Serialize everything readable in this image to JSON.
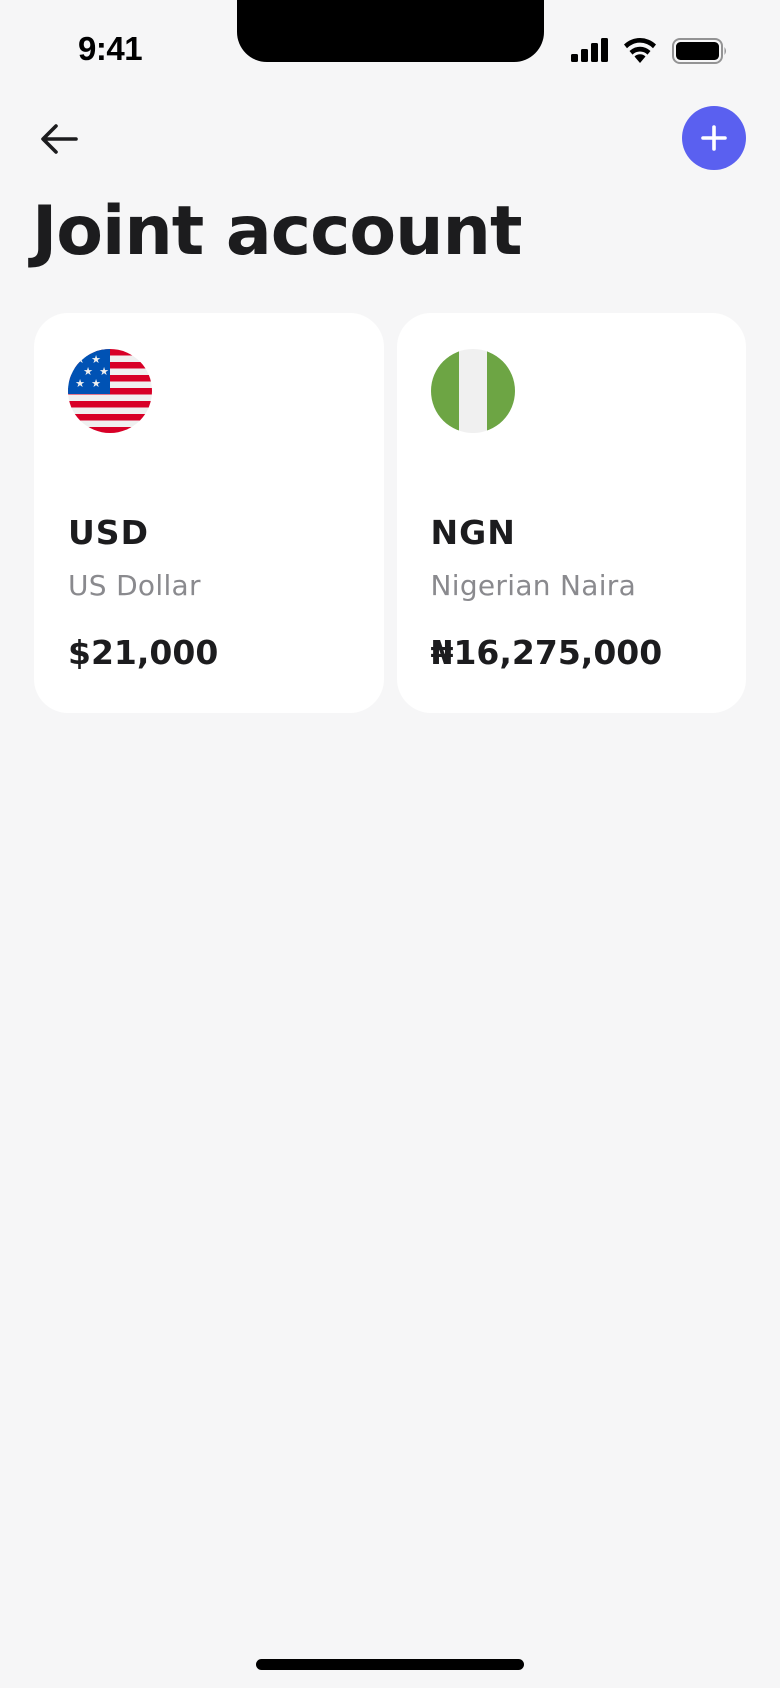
{
  "status_bar": {
    "time": "9:41"
  },
  "header": {
    "title": "Joint account",
    "back_icon": "arrow-left-icon",
    "add_icon": "plus-icon",
    "accent_color": "#5a60f0"
  },
  "accounts": [
    {
      "code": "USD",
      "name": "US Dollar",
      "balance": "$21,000",
      "flag_icon": "us-flag-icon"
    },
    {
      "code": "NGN",
      "name": "Nigerian Naira",
      "balance": "₦16,275,000",
      "flag_icon": "nigeria-flag-icon"
    }
  ]
}
